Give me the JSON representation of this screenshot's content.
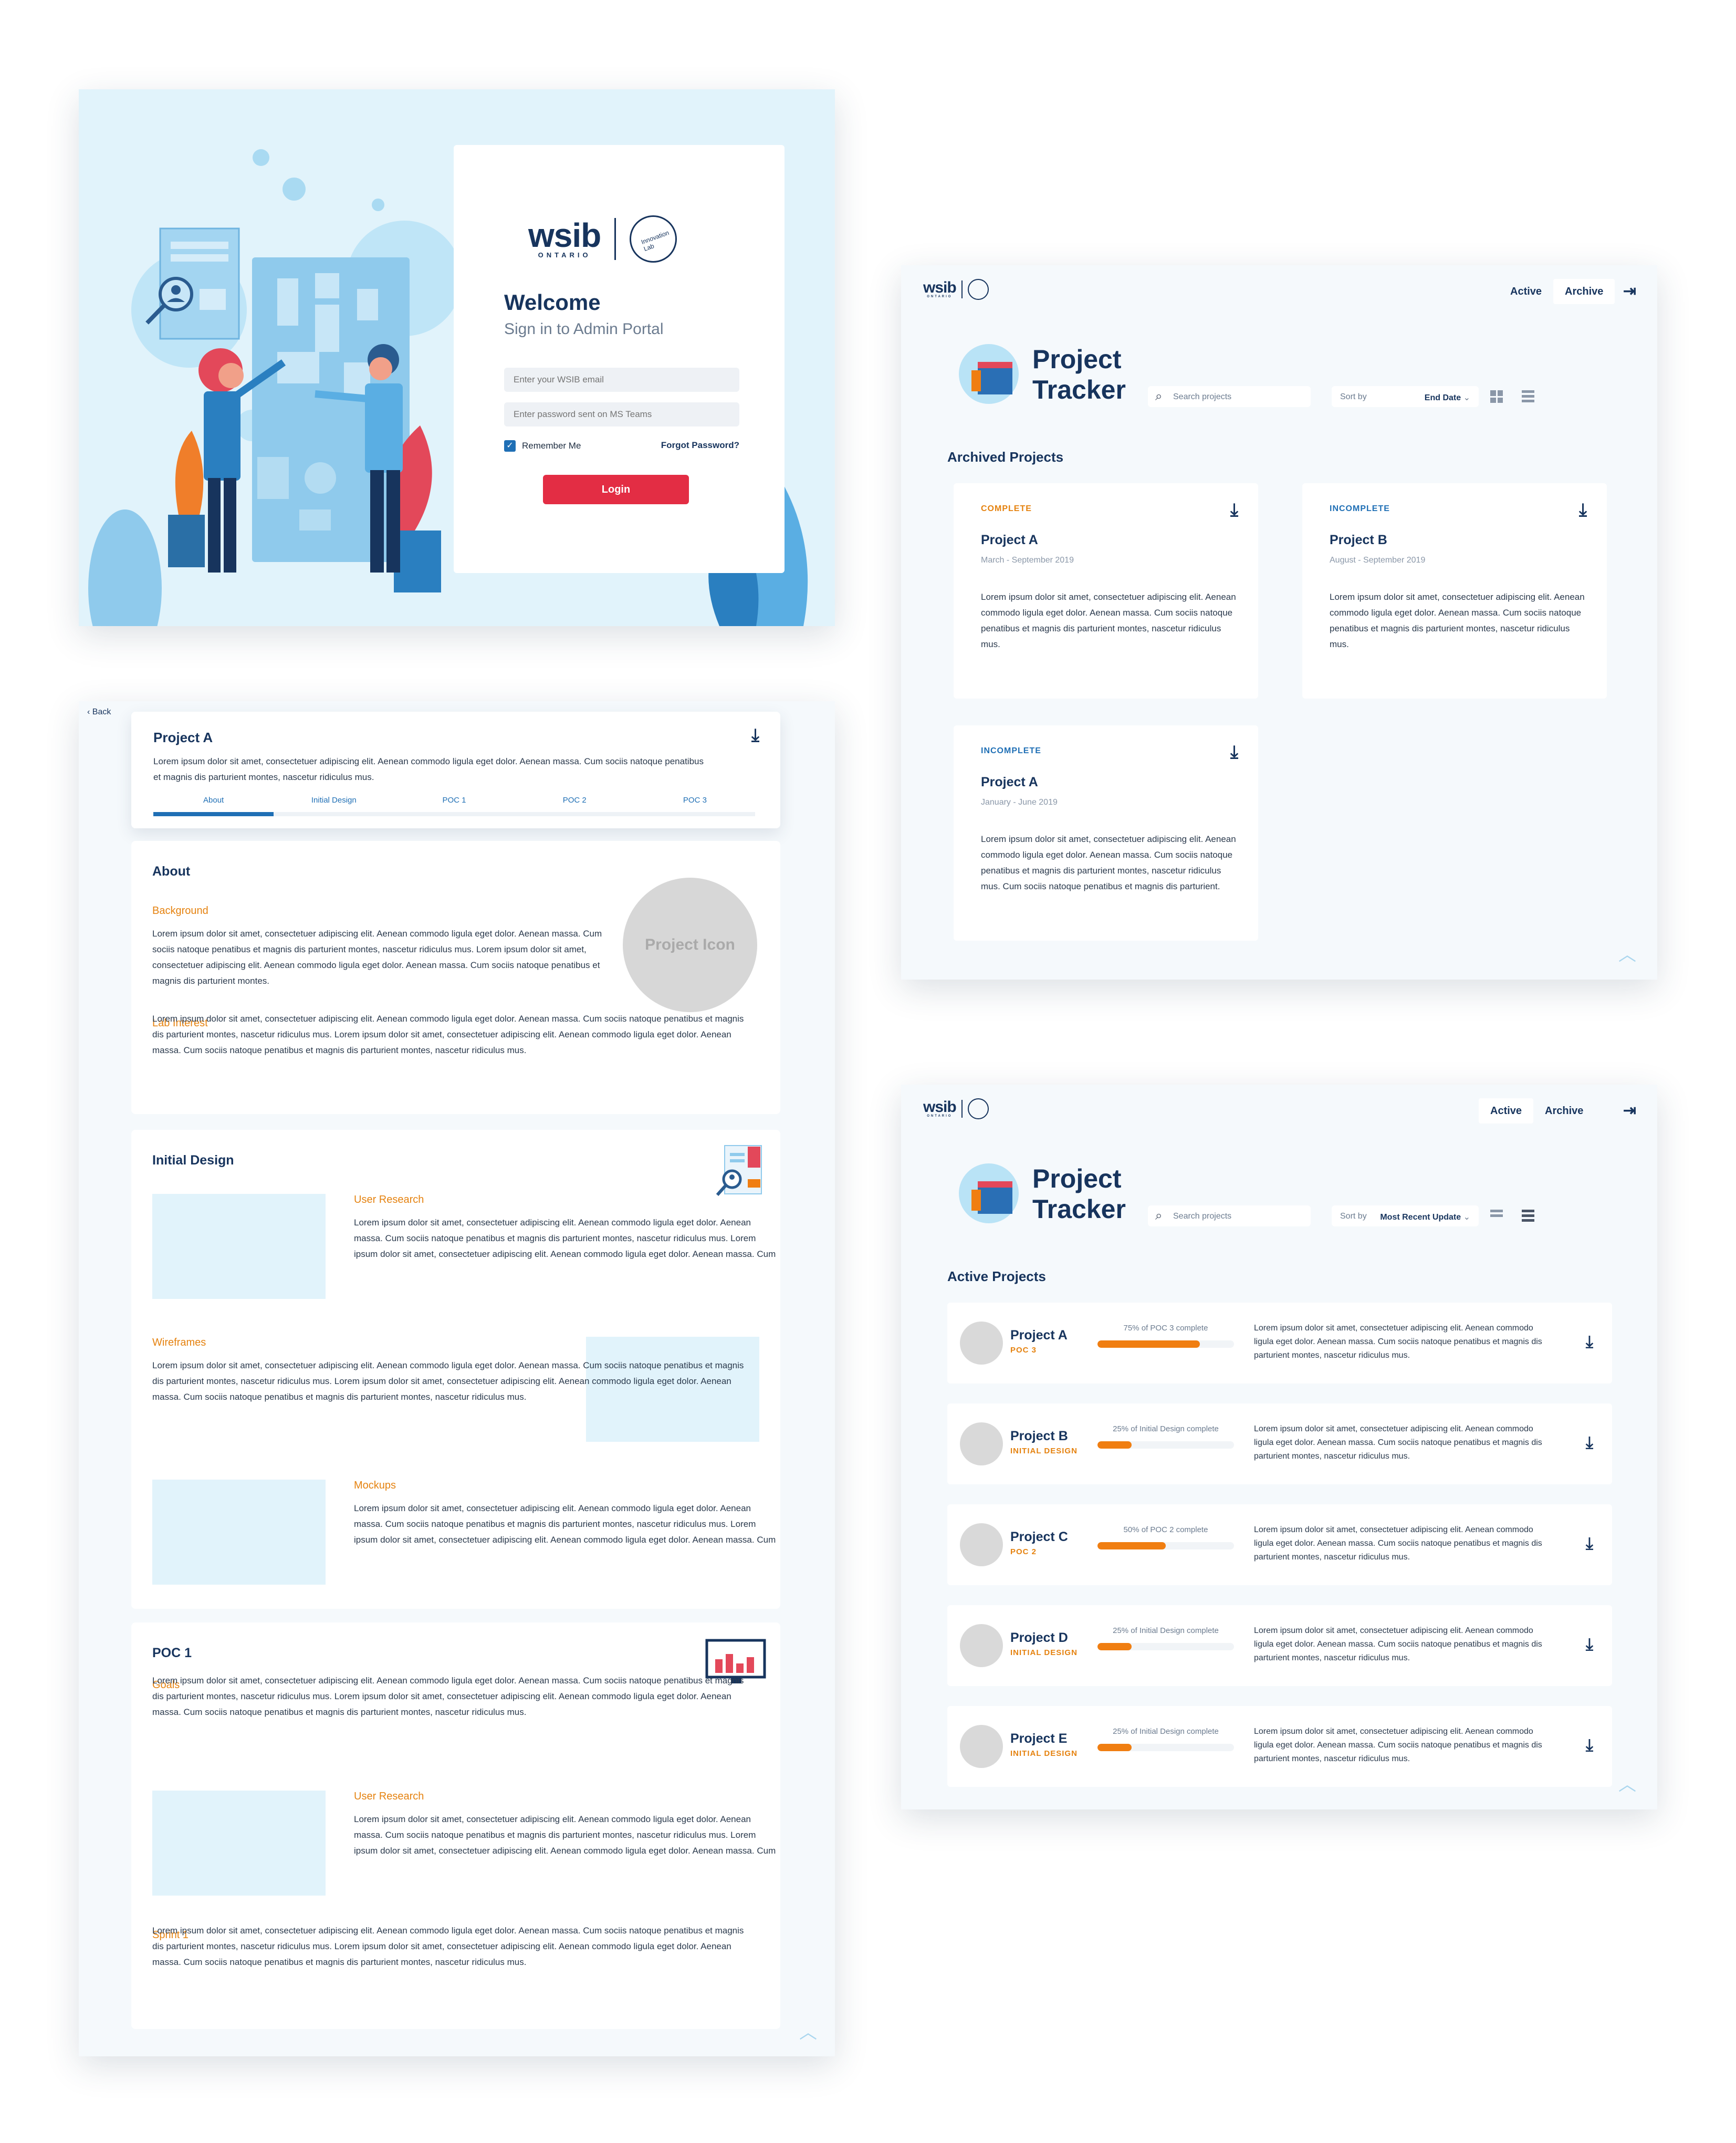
{
  "login": {
    "brand": "wsib",
    "brand_sub": "ONTARIO",
    "lab_name": "Innovation Lab",
    "welcome": "Welcome",
    "subtitle": "Sign in to Admin Portal",
    "email_placeholder": "Enter your WSIB email",
    "password_placeholder": "Enter password sent on MS Teams",
    "remember": "Remember Me",
    "forgot": "Forgot Password?",
    "login_button": "Login"
  },
  "nav": {
    "active": "Active",
    "archive": "Archive"
  },
  "tracker": {
    "title_line1": "Project",
    "title_line2": "Tracker",
    "search_placeholder": "Search projects",
    "sort_label": "Sort by"
  },
  "archive": {
    "sort_value": "End Date",
    "section_title": "Archived Projects",
    "cards": [
      {
        "status": "COMPLETE",
        "title": "Project A",
        "date": "March - September 2019",
        "text": "Lorem ipsum dolor sit amet, consectetuer adipiscing elit. Aenean commodo ligula eget dolor. Aenean massa. Cum sociis natoque penatibus et magnis dis parturient montes, nascetur ridiculus mus."
      },
      {
        "status": "INCOMPLETE",
        "title": "Project B",
        "date": "August - September 2019",
        "text": "Lorem ipsum dolor sit amet, consectetuer adipiscing elit. Aenean commodo ligula eget dolor. Aenean massa. Cum sociis natoque penatibus et magnis dis parturient montes, nascetur ridiculus mus."
      },
      {
        "status": "INCOMPLETE",
        "title": "Project A",
        "date": "January - June 2019",
        "text": "Lorem ipsum dolor sit amet, consectetuer adipiscing elit. Aenean commodo ligula eget dolor. Aenean massa. Cum sociis natoque penatibus et magnis dis parturient montes, nascetur ridiculus mus. Cum sociis natoque penatibus et magnis dis parturient."
      }
    ]
  },
  "active": {
    "sort_value": "Most Recent Update",
    "section_title": "Active Projects",
    "rows": [
      {
        "name": "Project A",
        "phase": "POC 3",
        "progress_text": "75% of POC 3 complete",
        "progress": 0.75,
        "text": "Lorem ipsum dolor sit amet, consectetuer adipiscing elit. Aenean commodo ligula eget dolor. Aenean massa. Cum sociis natoque penatibus et magnis dis parturient montes, nascetur ridiculus mus."
      },
      {
        "name": "Project B",
        "phase": "INITIAL DESIGN",
        "progress_text": "25% of Initial Design complete",
        "progress": 0.25,
        "text": "Lorem ipsum dolor sit amet, consectetuer adipiscing elit. Aenean commodo ligula eget dolor. Aenean massa. Cum sociis natoque penatibus et magnis dis parturient montes, nascetur ridiculus mus."
      },
      {
        "name": "Project C",
        "phase": "POC 2",
        "progress_text": "50% of POC 2 complete",
        "progress": 0.5,
        "text": "Lorem ipsum dolor sit amet, consectetuer adipiscing elit. Aenean commodo ligula eget dolor. Aenean massa. Cum sociis natoque penatibus et magnis dis parturient montes, nascetur ridiculus mus."
      },
      {
        "name": "Project D",
        "phase": "INITIAL DESIGN",
        "progress_text": "25% of Initial Design complete",
        "progress": 0.25,
        "text": "Lorem ipsum dolor sit amet, consectetuer adipiscing elit. Aenean commodo ligula eget dolor. Aenean massa. Cum sociis natoque penatibus et magnis dis parturient montes, nascetur ridiculus mus."
      },
      {
        "name": "Project E",
        "phase": "INITIAL DESIGN",
        "progress_text": "25% of Initial Design complete",
        "progress": 0.25,
        "text": "Lorem ipsum dolor sit amet, consectetuer adipiscing elit. Aenean commodo ligula eget dolor. Aenean massa. Cum sociis natoque penatibus et magnis dis parturient montes, nascetur ridiculus mus."
      }
    ]
  },
  "detail": {
    "back": "Back",
    "title": "Project A",
    "desc": "Lorem ipsum dolor sit amet, consectetuer adipiscing elit. Aenean commodo ligula eget dolor. Aenean massa. Cum sociis natoque penatibus et magnis dis parturient montes, nascetur ridiculus mus.",
    "tabs": [
      "About",
      "Initial Design",
      "POC 1",
      "POC 2",
      "POC 3"
    ],
    "about": {
      "heading": "About",
      "background_label": "Background",
      "background_text": "Lorem ipsum dolor sit amet, consectetuer adipiscing elit. Aenean commodo ligula eget dolor. Aenean massa. Cum sociis natoque penatibus et magnis dis parturient montes, nascetur ridiculus mus. Lorem ipsum dolor sit amet, consectetuer adipiscing elit. Aenean commodo ligula eget dolor. Aenean massa. Cum sociis natoque penatibus et magnis dis parturient montes.",
      "icon_label": "Project Icon",
      "lab_interest_label": "Lab Interest",
      "lab_interest_text": "Lorem ipsum dolor sit amet, consectetuer adipiscing elit. Aenean commodo ligula eget dolor. Aenean massa. Cum sociis natoque penatibus et magnis dis parturient montes, nascetur ridiculus mus. Lorem ipsum dolor sit amet, consectetuer adipiscing elit. Aenean commodo ligula eget dolor. Aenean massa. Cum sociis natoque penatibus et magnis dis parturient montes, nascetur ridiculus mus."
    },
    "initial_design": {
      "heading": "Initial Design",
      "user_research_label": "User Research",
      "user_research_text": "Lorem ipsum dolor sit amet, consectetuer adipiscing elit. Aenean commodo ligula eget dolor. Aenean massa. Cum sociis natoque penatibus et magnis dis parturient montes, nascetur ridiculus mus. Lorem ipsum dolor sit amet, consectetuer adipiscing elit. Aenean commodo ligula eget dolor. Aenean massa. Cum sociis natoque penatibus et magnis dis parturient montes, nascetur ridiculus mus.",
      "wireframes_label": "Wireframes",
      "wireframes_text": "Lorem ipsum dolor sit amet, consectetuer adipiscing elit. Aenean commodo ligula eget dolor. Aenean massa. Cum sociis natoque penatibus et magnis dis parturient montes, nascetur ridiculus mus. Lorem ipsum dolor sit amet, consectetuer adipiscing elit. Aenean commodo ligula eget dolor. Aenean massa. Cum sociis natoque penatibus et magnis dis parturient montes, nascetur ridiculus mus.",
      "mockups_label": "Mockups",
      "mockups_text": "Lorem ipsum dolor sit amet, consectetuer adipiscing elit. Aenean commodo ligula eget dolor. Aenean massa. Cum sociis natoque penatibus et magnis dis parturient montes, nascetur ridiculus mus. Lorem ipsum dolor sit amet, consectetuer adipiscing elit. Aenean commodo ligula eget dolor. Aenean massa. Cum sociis natoque penatibus et magnis dis parturient montes, nascetur ridiculus mus."
    },
    "poc1": {
      "heading": "POC 1",
      "goals_label": "Goals",
      "goals_text": "Lorem ipsum dolor sit amet, consectetuer adipiscing elit. Aenean commodo ligula eget dolor. Aenean massa. Cum sociis natoque penatibus et magnis dis parturient montes, nascetur ridiculus mus. Lorem ipsum dolor sit amet, consectetuer adipiscing elit. Aenean commodo ligula eget dolor. Aenean massa. Cum sociis natoque penatibus et magnis dis parturient montes, nascetur ridiculus mus.",
      "user_research_label": "User Research",
      "user_research_text": "Lorem ipsum dolor sit amet, consectetuer adipiscing elit. Aenean commodo ligula eget dolor. Aenean massa. Cum sociis natoque penatibus et magnis dis parturient montes, nascetur ridiculus mus. Lorem ipsum dolor sit amet, consectetuer adipiscing elit. Aenean commodo ligula eget dolor. Aenean massa. Cum sociis natoque penatibus et magnis dis parturient montes, nascetur ridiculus mus.",
      "sprint_label": "Sprint 1",
      "sprint_text": "Lorem ipsum dolor sit amet, consectetuer adipiscing elit. Aenean commodo ligula eget dolor. Aenean massa. Cum sociis natoque penatibus et magnis dis parturient montes, nascetur ridiculus mus. Lorem ipsum dolor sit amet, consectetuer adipiscing elit. Aenean commodo ligula eget dolor. Aenean massa. Cum sociis natoque penatibus et magnis dis parturient montes, nascetur ridiculus mus."
    }
  },
  "colors": {
    "navy": "#17345d",
    "accent_red": "#e32d44",
    "orange": "#f07e11",
    "light_blue": "#e1f3fb",
    "link_blue": "#1f6fb5"
  },
  "icons": [
    "download-icon",
    "logout-icon",
    "search-icon",
    "chevron-down-icon",
    "chevron-up-icon",
    "grid-view-icon",
    "list-view-icon",
    "back-chevron-icon",
    "checkbox-icon"
  ]
}
